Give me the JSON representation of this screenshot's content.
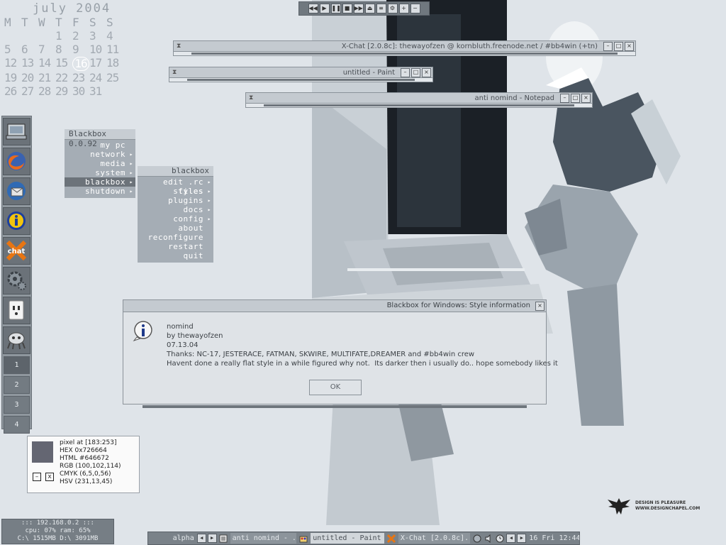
{
  "calendar": {
    "month": "july 2004",
    "headers": [
      "M",
      "T",
      "W",
      "T",
      "F",
      "S",
      "S"
    ],
    "weeks": [
      [
        "",
        "",
        "",
        "1",
        "2",
        "3",
        "4"
      ],
      [
        "5",
        "6",
        "7",
        "8",
        "9",
        "10",
        "11"
      ],
      [
        "12",
        "13",
        "14",
        "15",
        "16",
        "17",
        "18"
      ],
      [
        "19",
        "20",
        "21",
        "22",
        "23",
        "24",
        "25"
      ],
      [
        "26",
        "27",
        "28",
        "29",
        "30",
        "31",
        ""
      ]
    ],
    "today": "16"
  },
  "media_bar": {
    "buttons": [
      "rewind-icon",
      "play-icon",
      "pause-icon",
      "stop-icon",
      "fast-forward-icon",
      "eject-icon",
      "playlist-icon",
      "settings-icon",
      "volume-up-icon",
      "volume-down-icon"
    ]
  },
  "windows": {
    "xchat": {
      "title": "X-Chat [2.0.8c]: thewayofzen @ kornbluth.freenode.net / #bb4win (+tn)"
    },
    "paint": {
      "title": "untitled - Paint"
    },
    "notepad": {
      "title": "anti nomind - Notepad"
    }
  },
  "dock": {
    "icons": [
      "my-computer-icon",
      "firefox-icon",
      "thunderbird-icon",
      "info-icon",
      "chat-icon",
      "settings-gear-icon",
      "power-outlet-icon",
      "robot-icon"
    ],
    "chat_label": "chat",
    "workspaces": [
      "1",
      "2",
      "3",
      "4"
    ]
  },
  "menu_main": {
    "title": "Blackbox 0.0.92",
    "items": [
      {
        "label": "my pc",
        "submenu": false
      },
      {
        "label": "network",
        "submenu": true
      },
      {
        "label": "media",
        "submenu": true
      },
      {
        "label": "system",
        "submenu": true
      },
      {
        "label": "blackbox",
        "submenu": true,
        "active": true
      },
      {
        "label": "shutdown",
        "submenu": true
      }
    ]
  },
  "menu_blackbox": {
    "title": "blackbox",
    "items": [
      {
        "label": "edit .rc files",
        "submenu": true
      },
      {
        "label": "styles",
        "submenu": true
      },
      {
        "label": "plugins",
        "submenu": true
      },
      {
        "label": "docs",
        "submenu": true
      },
      {
        "label": "config",
        "submenu": true
      },
      {
        "label": "about",
        "submenu": false
      },
      {
        "label": "reconfigure",
        "submenu": false
      },
      {
        "label": "restart",
        "submenu": false
      },
      {
        "label": "quit",
        "submenu": false
      }
    ]
  },
  "dialog": {
    "title": "Blackbox for Windows: Style information",
    "lines": [
      "nomind",
      "by thewayofzen",
      "07.13.04",
      "Thanks: NC-17, JESTERACE, FATMAN, SKWIRE, MULTIFATE,DREAMER and #bb4win crew",
      "Havent done a really flat style in a while figured why not.  Its darker then i usually do.. hope somebody likes it"
    ],
    "ok_label": "OK"
  },
  "color_picker": {
    "swatch_color": "#646672",
    "lines": [
      "pixel at [183:253]",
      "HEX 0x726664",
      "HTML #646672",
      "RGB (100,102,114)",
      "CMYK (6,5,0,56)",
      "HSV (231,13,45)"
    ],
    "minimize_label": "–",
    "close_label": "x"
  },
  "sysinfo": {
    "ip": "::: 192.168.0.2 :::",
    "cpu_ram": "cpu: 07%     ram: 65%",
    "disks": "C:\\ 1515MB   D:\\ 3091MB"
  },
  "taskbar": {
    "workspace_label": "alpha",
    "tasks": [
      {
        "label": "anti nomind - ...",
        "active": false
      },
      {
        "label": "untitled - Paint",
        "active": true
      },
      {
        "label": "X-Chat [2.0.8c]...",
        "active": false
      }
    ],
    "clock": "16 Fri 12:44"
  },
  "branding": {
    "line1": "DESIGN IS PLEASURE",
    "line2": "WWW.DESIGNCHAPEL.COM"
  },
  "colors": {
    "accent": "#6c737a",
    "menu_bg": "#a5adb5",
    "dialog_bg": "#dfe3e7",
    "titlebar": "#c4cad0"
  }
}
